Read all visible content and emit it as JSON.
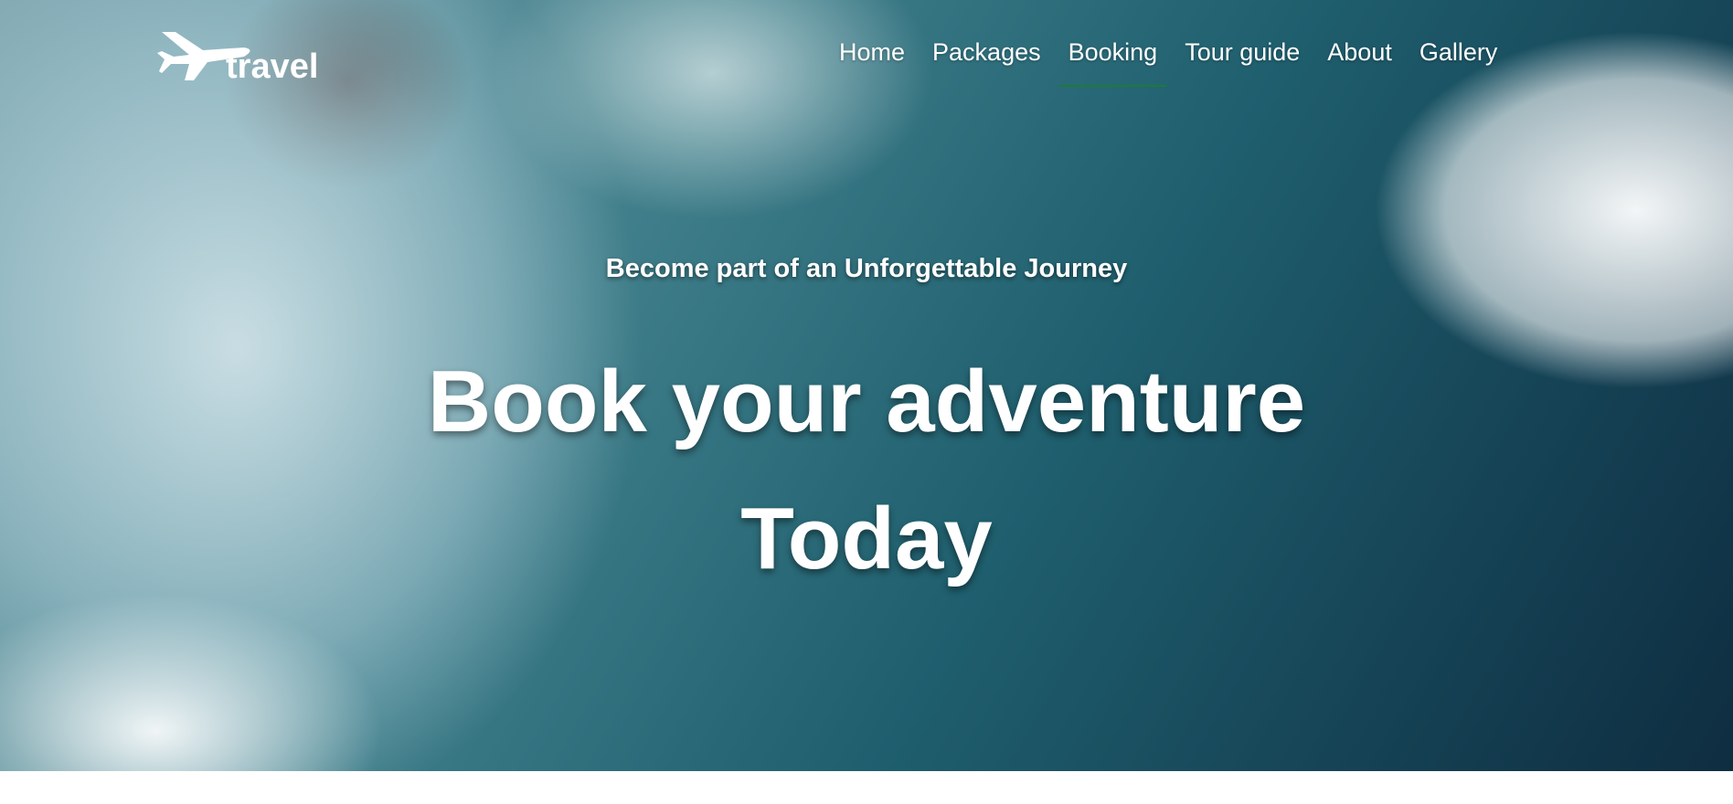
{
  "logo": {
    "text": "travel",
    "icon": "airplane-icon"
  },
  "nav": {
    "items": [
      {
        "label": "Home"
      },
      {
        "label": "Packages"
      },
      {
        "label": "Booking",
        "active": true
      },
      {
        "label": "Tour guide"
      },
      {
        "label": "About"
      },
      {
        "label": "Gallery"
      }
    ],
    "active_color": "#1e7a3a"
  },
  "hero": {
    "subtitle": "Become part of an Unforgettable Journey",
    "title_line1": "Book your adventure",
    "title_line2": "Today"
  }
}
